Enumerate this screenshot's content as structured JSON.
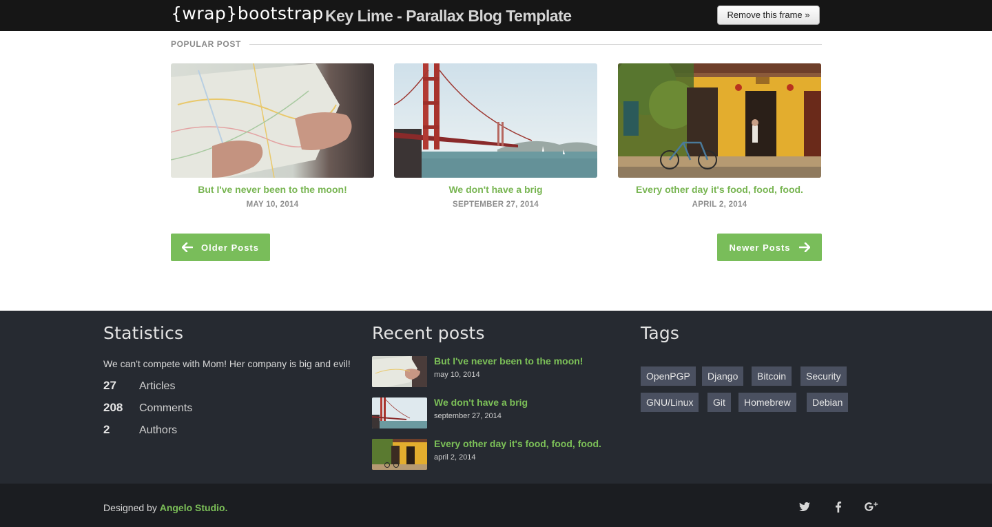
{
  "frame": {
    "logo": "{wrap}bootstrap",
    "title": "Key Lime - Parallax Blog Template",
    "remove_button": "Remove this frame »"
  },
  "popular": {
    "heading": "POPULAR POST",
    "posts": [
      {
        "title": "But I've never been to the moon!",
        "date": "MAY 10, 2014",
        "image": "hands-holding-map"
      },
      {
        "title": "We don't have a brig",
        "date": "SEPTEMBER 27, 2014",
        "image": "golden-gate-bridge"
      },
      {
        "title": "Every other day it's food, food, food.",
        "date": "APRIL 2, 2014",
        "image": "yellow-house-bicycle"
      }
    ]
  },
  "pagination": {
    "older": "Older Posts",
    "newer": "Newer Posts"
  },
  "footer": {
    "statistics": {
      "heading": "Statistics",
      "text": "We can't compete with Mom! Her company is big and evil!",
      "rows": [
        {
          "value": "27",
          "label": "Articles"
        },
        {
          "value": "208",
          "label": "Comments"
        },
        {
          "value": "2",
          "label": "Authors"
        }
      ]
    },
    "recent": {
      "heading": "Recent posts",
      "posts": [
        {
          "title": "But I've never been to the moon!",
          "date": "may 10, 2014"
        },
        {
          "title": "We don't have a brig",
          "date": "september 27, 2014"
        },
        {
          "title": "Every other day it's food, food, food.",
          "date": "april 2, 2014"
        }
      ]
    },
    "tags": {
      "heading": "Tags",
      "items": [
        "OpenPGP",
        "Django",
        "Bitcoin",
        "Security",
        "GNU/Linux",
        "Git",
        "Homebrew",
        "Debian"
      ]
    },
    "credit_prefix": "Designed by ",
    "credit_link": "Angelo Studio.",
    "social": [
      "twitter-icon",
      "facebook-icon",
      "google-plus-icon"
    ]
  },
  "colors": {
    "accent": "#79bd5a",
    "frame_bg": "#161616",
    "footer_bg": "#262a31",
    "bottom_bg": "#1b1d21",
    "tag_bg": "#4a5060"
  }
}
